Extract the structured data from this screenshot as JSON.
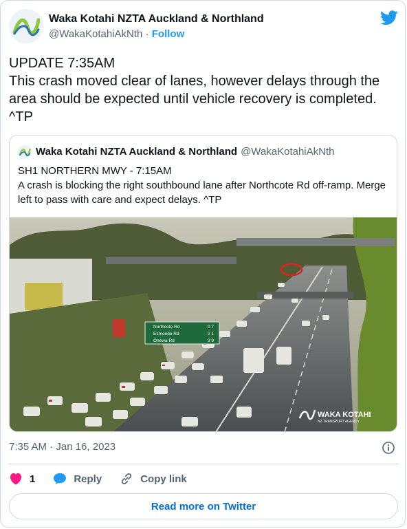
{
  "author": {
    "name": "Waka Kotahi NZTA Auckland & Northland",
    "handle": "@WakaKotahiAkNth",
    "separator": "·",
    "follow_label": "Follow"
  },
  "tweet": {
    "lines": [
      "UPDATE 7:35AM",
      "This crash moved clear of lanes, however delays through the area should be expected until vehicle recovery is completed. ^TP"
    ],
    "timestamp": "7:35 AM · Jan 16, 2023"
  },
  "quoted": {
    "name": "Waka Kotahi NZTA Auckland & Northland",
    "handle": "@WakaKotahiAkNth",
    "lines": [
      "SH1 NORTHERN MWY - 7:15AM",
      "A crash is blocking the right southbound lane after Northcote Rd off-ramp. Merge left to pass with care and expect delays. ^TP"
    ],
    "image": {
      "sign_rows": [
        {
          "place": "Northcote Rd",
          "time": "0 7"
        },
        {
          "place": "Esmonde Rd",
          "time": "2 1"
        },
        {
          "place": "Onewa Rd",
          "time": "3 9"
        }
      ],
      "watermark_title": "WAKA KOTAHI",
      "watermark_sub": "NZ TRANSPORT AGENCY"
    }
  },
  "actions": {
    "like_count": "1",
    "reply_label": "Reply",
    "copy_label": "Copy link"
  },
  "read_more_label": "Read more on Twitter",
  "colors": {
    "accent": "#1d9bf0",
    "like": "#f91880",
    "link": "#006fd6",
    "muted": "#536471"
  }
}
